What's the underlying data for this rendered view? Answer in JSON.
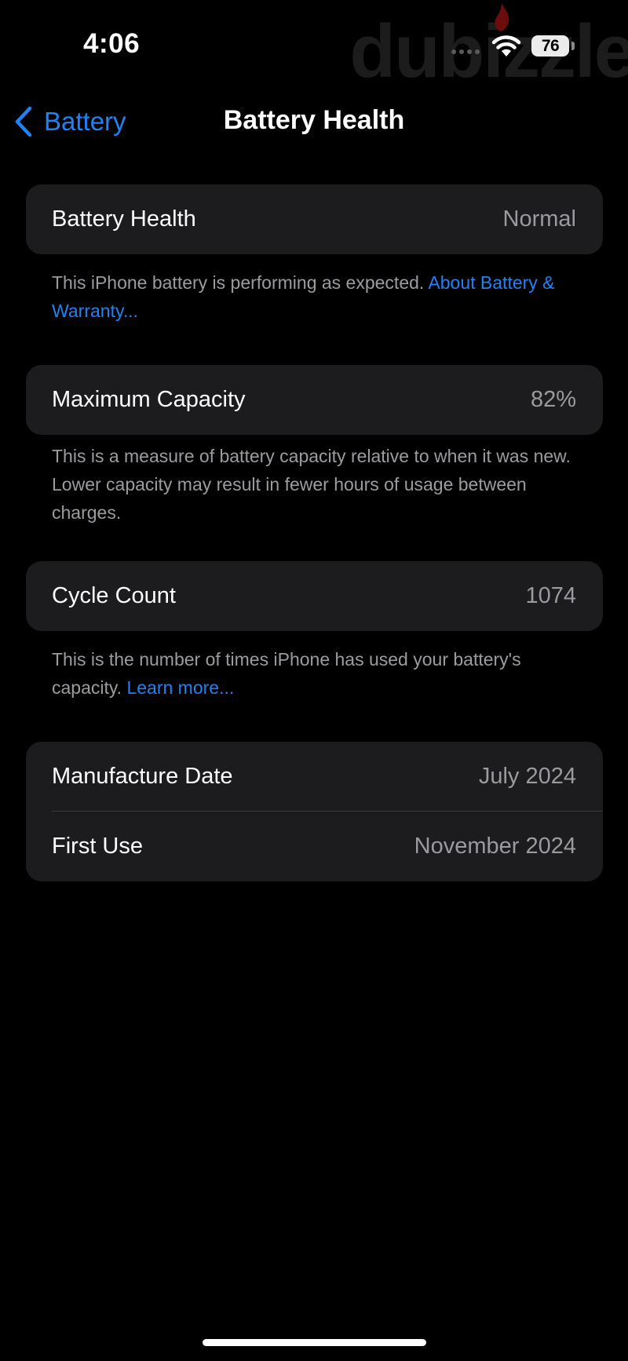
{
  "status_bar": {
    "time": "4:06",
    "battery_level": "76",
    "watermark": "dubizzle",
    "icons": [
      "cellular-dots-icon",
      "wifi-icon",
      "battery-icon",
      "flame-icon"
    ]
  },
  "nav": {
    "back_label": "Battery",
    "title": "Battery Health"
  },
  "sections": {
    "health": {
      "label": "Battery Health",
      "value": "Normal",
      "footnote_text": "This iPhone battery is performing as expected. ",
      "footnote_link": "About Battery & Warranty..."
    },
    "capacity": {
      "label": "Maximum Capacity",
      "value": "82%",
      "footnote_text": "This is a measure of battery capacity relative to when it was new. Lower capacity may result in fewer hours of usage between charges."
    },
    "cycles": {
      "label": "Cycle Count",
      "value": "1074",
      "footnote_text": "This is the number of times iPhone has used your battery's capacity. ",
      "footnote_link": "Learn more..."
    },
    "dates": {
      "manufacture_label": "Manufacture Date",
      "manufacture_value": "July 2024",
      "first_use_label": "First Use",
      "first_use_value": "November 2024"
    }
  },
  "colors": {
    "background": "#000000",
    "card": "#1c1c1e",
    "accent": "#1f82f5",
    "secondary_text": "#9a9a9f"
  }
}
